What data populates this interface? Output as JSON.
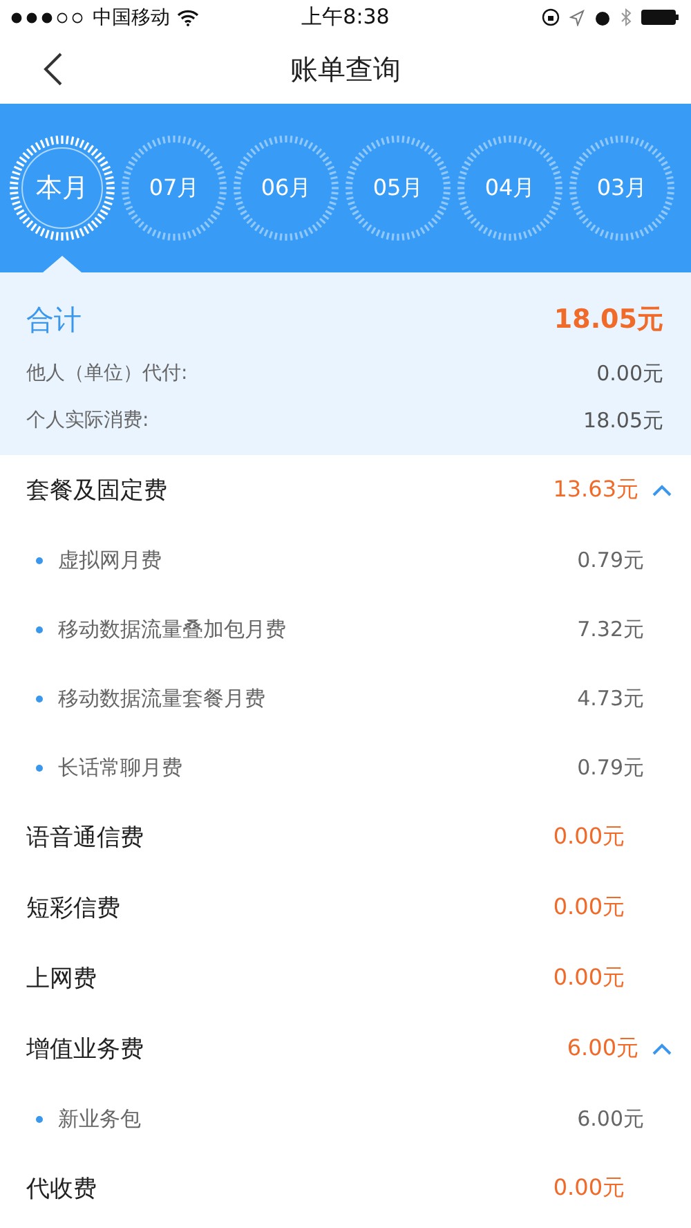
{
  "status_bar": {
    "carrier": "中国移动",
    "time": "上午8:38"
  },
  "nav": {
    "title": "账单查询"
  },
  "months": [
    {
      "label": "本月",
      "selected": true
    },
    {
      "label": "07月",
      "selected": false
    },
    {
      "label": "06月",
      "selected": false
    },
    {
      "label": "05月",
      "selected": false
    },
    {
      "label": "04月",
      "selected": false
    },
    {
      "label": "03月",
      "selected": false
    }
  ],
  "summary": {
    "total_label": "合计",
    "total": "18.05元",
    "rows": [
      {
        "label": "他人（单位）代付:",
        "value": "0.00元"
      },
      {
        "label": "个人实际消费:",
        "value": "18.05元"
      }
    ]
  },
  "sections": [
    {
      "name": "套餐及固定费",
      "amount": "13.63元",
      "expanded": true,
      "items": [
        {
          "name": "虚拟网月费",
          "amount": "0.79元"
        },
        {
          "name": "移动数据流量叠加包月费",
          "amount": "7.32元"
        },
        {
          "name": "移动数据流量套餐月费",
          "amount": "4.73元"
        },
        {
          "name": "长话常聊月费",
          "amount": "0.79元"
        }
      ]
    },
    {
      "name": "语音通信费",
      "amount": "0.00元"
    },
    {
      "name": "短彩信费",
      "amount": "0.00元"
    },
    {
      "name": "上网费",
      "amount": "0.00元"
    },
    {
      "name": "增值业务费",
      "amount": "6.00元",
      "expanded": true,
      "items": [
        {
          "name": "新业务包",
          "amount": "6.00元"
        }
      ]
    },
    {
      "name": "代收费",
      "amount": "0.00元"
    }
  ]
}
